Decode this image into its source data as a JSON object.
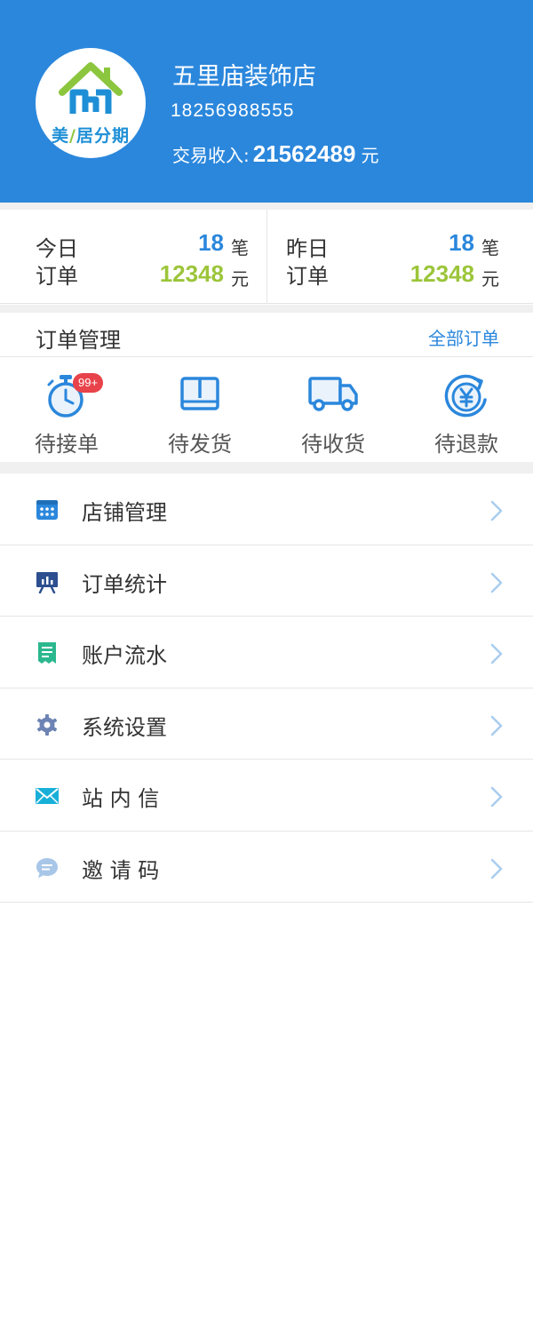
{
  "header": {
    "logo": {
      "text_a": "美",
      "text_b": "居分期",
      "slash": "/"
    },
    "shop_name": "五里庙装饰店",
    "phone": "18256988555",
    "income_label": "交易收入:",
    "income_amount": "21562489",
    "income_unit": "元"
  },
  "stats": {
    "today": {
      "label_1": "今日",
      "label_2": "订单",
      "count": "18",
      "count_unit": "笔",
      "amount": "12348",
      "amount_unit": "元"
    },
    "yesterday": {
      "label_1": "昨日",
      "label_2": "订单",
      "count": "18",
      "count_unit": "笔",
      "amount": "12348",
      "amount_unit": "元"
    }
  },
  "order_management": {
    "title": "订单管理",
    "all_orders_link": "全部订单",
    "statuses": [
      {
        "label": "待接单",
        "icon": "stopwatch-icon",
        "badge": "99+"
      },
      {
        "label": "待发货",
        "icon": "box-icon"
      },
      {
        "label": "待收货",
        "icon": "truck-icon"
      },
      {
        "label": "待退款",
        "icon": "refund-yen-icon"
      }
    ]
  },
  "menu": {
    "items": [
      {
        "label": "店铺管理",
        "icon": "calendar-grid-icon"
      },
      {
        "label": "订单统计",
        "icon": "chart-board-icon"
      },
      {
        "label": "账户流水",
        "icon": "receipt-icon"
      },
      {
        "label": "系统设置",
        "icon": "gear-icon"
      },
      {
        "label": "站 内 信",
        "icon": "envelope-icon"
      },
      {
        "label": "邀 请 码",
        "icon": "chat-bubble-icon"
      }
    ]
  },
  "colors": {
    "primary": "#2b87dc",
    "amount_green": "#9cc53a",
    "badge_red": "#e8434a",
    "arrow_blue": "#a9cdef"
  }
}
